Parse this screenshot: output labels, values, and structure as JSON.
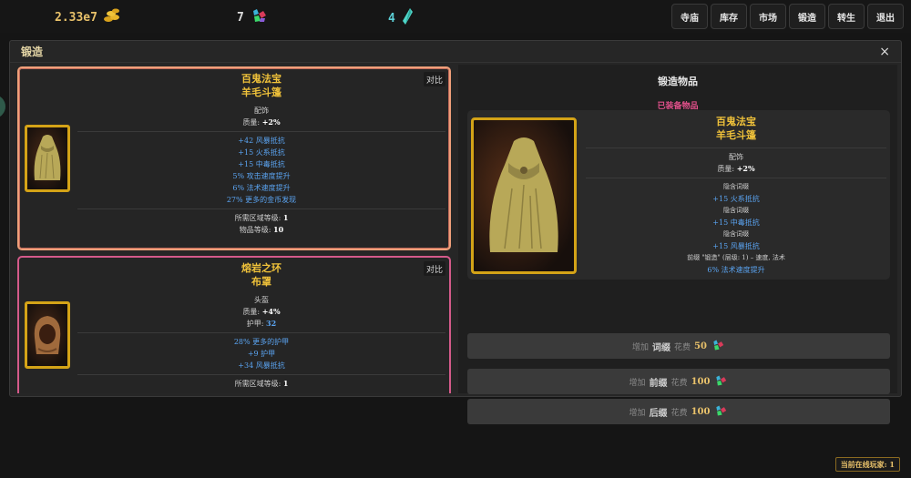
{
  "topbar": {
    "gold": {
      "value": "2.33e7",
      "icon": "gold-coins-icon"
    },
    "gems": {
      "value": "7",
      "icon": "gems-icon"
    },
    "shards": {
      "value": "4",
      "icon": "crystal-shard-icon"
    },
    "nav": [
      "寺庙",
      "库存",
      "市场",
      "锻造",
      "转生",
      "退出"
    ]
  },
  "modal": {
    "title": "锻造",
    "close": "×"
  },
  "items": [
    {
      "prefix_name": "百鬼法宝",
      "base_name": "羊毛斗篷",
      "compare": "对比",
      "type": "配饰",
      "quality_label": "质量: ",
      "quality_value": "+2%",
      "mods": [
        "+42 风暴抵抗",
        "+15 火系抵抗",
        "+15 中毒抵抗",
        "5% 攻击速度提升",
        "6% 法术速度提升",
        "27% 更多的金币发现"
      ],
      "req_label": "所需区域等级: ",
      "req_value": "1",
      "ilvl_label": "物品等级: ",
      "ilvl_value": "10"
    },
    {
      "prefix_name": "熔岩之环",
      "base_name": "布罩",
      "compare": "对比",
      "type": "头盔",
      "quality_label": "质量: ",
      "quality_value": "+4%",
      "armor_label": "护甲: ",
      "armor_value": "32",
      "mods": [
        "28% 更多的护甲",
        "+9 护甲",
        "+34 风暴抵抗"
      ],
      "req_label": "所需区域等级: ",
      "req_value": "1"
    }
  ],
  "forge": {
    "title": "锻造物品",
    "equipped_label": "已装备物品",
    "item": {
      "prefix_name": "百鬼法宝",
      "base_name": "羊毛斗篷",
      "type": "配饰",
      "quality_label": "质量: ",
      "quality_value": "+2%",
      "lines": [
        {
          "text": "隐含词缀",
          "kind": "small"
        },
        {
          "text": "+15 火系抵抗",
          "kind": "blue"
        },
        {
          "text": "隐含词缀",
          "kind": "small"
        },
        {
          "text": "+15 中毒抵抗",
          "kind": "blue"
        },
        {
          "text": "隐含词缀",
          "kind": "small"
        },
        {
          "text": "+15 风暴抵抗",
          "kind": "blue"
        },
        {
          "text": "前缀 \"锻造\" (层级: 1) – 速度, 法术",
          "kind": "small"
        },
        {
          "text": "6% 法术速度提升",
          "kind": "blue"
        }
      ]
    },
    "actions": [
      {
        "verb": "增加",
        "what": "词缀",
        "cost_label": "花费",
        "cost": "50",
        "icon": "gems-icon"
      },
      {
        "verb": "增加",
        "what": "前缀",
        "cost_label": "花费",
        "cost": "100",
        "icon": "gems-icon"
      },
      {
        "verb": "增加",
        "what": "后缀",
        "cost_label": "花费",
        "cost": "100",
        "icon": "gems-icon"
      }
    ]
  },
  "footer": {
    "online": "当前在线玩家: 1"
  }
}
